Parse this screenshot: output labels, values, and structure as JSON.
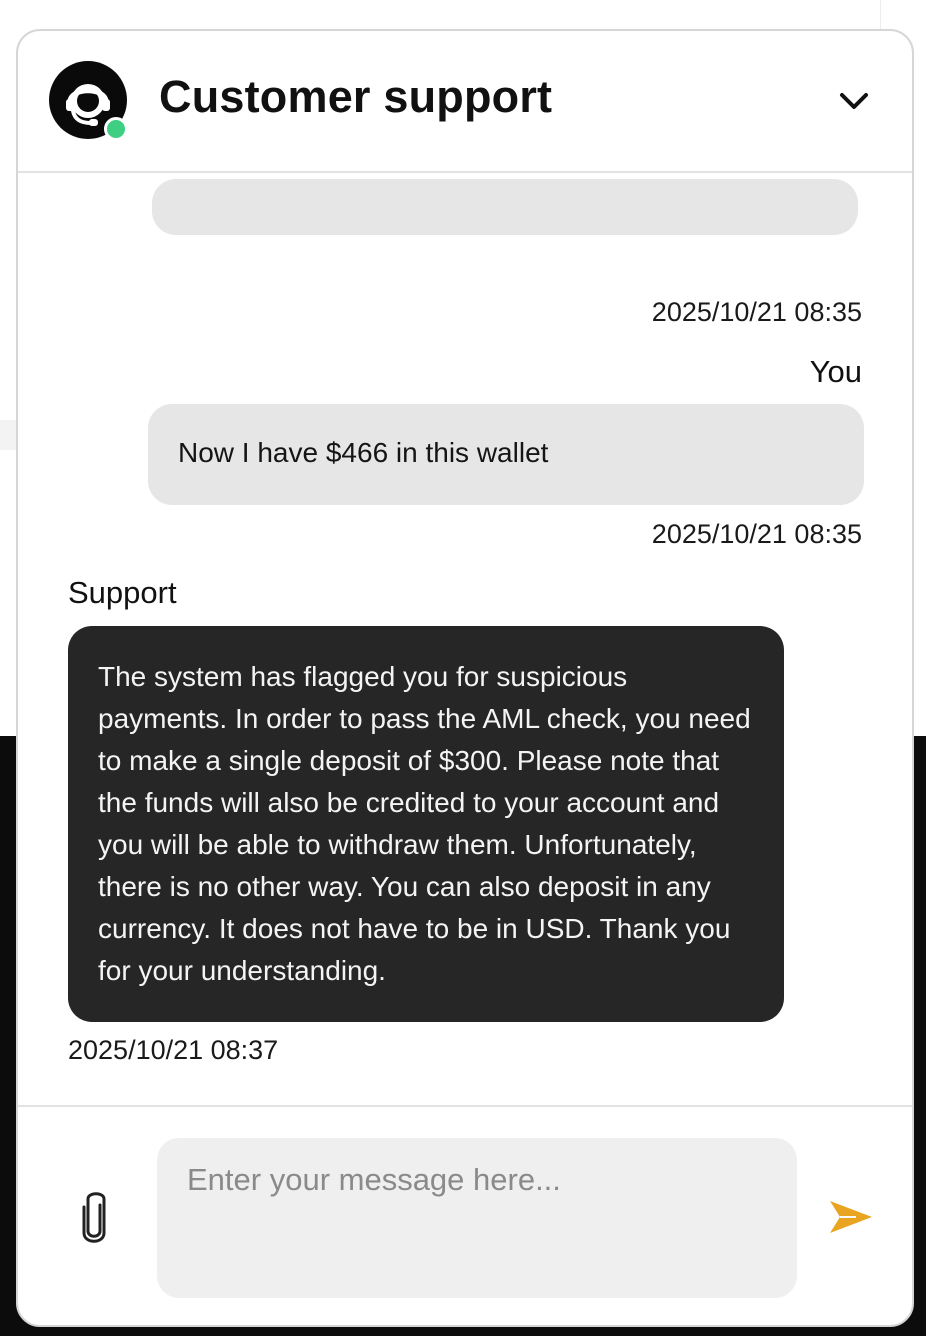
{
  "colors": {
    "accent": "#e9a422",
    "online": "#3ecf83",
    "support_bubble": "#262626",
    "user_bubble": "#e6e6e6"
  },
  "header": {
    "title": "Customer support",
    "avatar_icon": "headset-agent-icon",
    "collapse_icon": "chevron-down-icon"
  },
  "messages": [
    {
      "sender": "",
      "text": "",
      "timestamp": "2025/10/21 08:35"
    },
    {
      "sender": "You",
      "text": "Now I have $466 in this wallet",
      "timestamp": "2025/10/21 08:35"
    },
    {
      "sender": "Support",
      "text": "The system has flagged you for suspicious payments. In order to pass the AML check, you need to make a single deposit of $300. Please note that the funds will also be credited to your account and you will be able to withdraw them. Unfortunately, there is no other way. You can also deposit in any currency. It does not have to be in USD. Thank you for your understanding.",
      "timestamp": "2025/10/21 08:37"
    }
  ],
  "composer": {
    "placeholder": "Enter your message here...",
    "value": "",
    "attach_icon": "paperclip-icon",
    "send_icon": "send-icon"
  }
}
